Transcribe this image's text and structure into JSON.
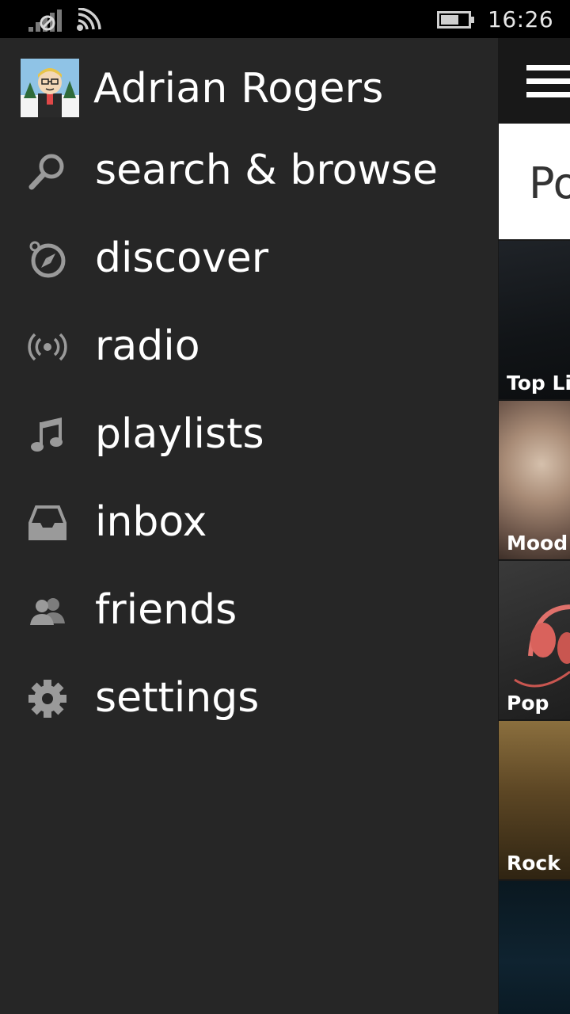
{
  "status_bar": {
    "time": "16:26",
    "icons": [
      "signal-icon",
      "wifi-icon",
      "battery-icon"
    ]
  },
  "profile": {
    "name": "Adrian Rogers",
    "avatar": "avatar-image"
  },
  "menu": {
    "items": [
      {
        "label": "search & browse",
        "icon": "search-icon"
      },
      {
        "label": "discover",
        "icon": "compass-icon"
      },
      {
        "label": "radio",
        "icon": "radio-icon"
      },
      {
        "label": "playlists",
        "icon": "music-note-icon"
      },
      {
        "label": "inbox",
        "icon": "inbox-icon"
      },
      {
        "label": "friends",
        "icon": "friends-icon"
      },
      {
        "label": "settings",
        "icon": "gear-icon"
      }
    ]
  },
  "peek": {
    "header_text": "Po",
    "tiles": [
      {
        "label": "Top Lists"
      },
      {
        "label": "Mood"
      },
      {
        "label": "Pop"
      },
      {
        "label": "Rock"
      },
      {
        "label": ""
      }
    ]
  },
  "colors": {
    "drawer_bg": "#262626",
    "status_bar_bg": "#000000",
    "icon_gray": "#9a9a9a",
    "text": "#ffffff"
  }
}
